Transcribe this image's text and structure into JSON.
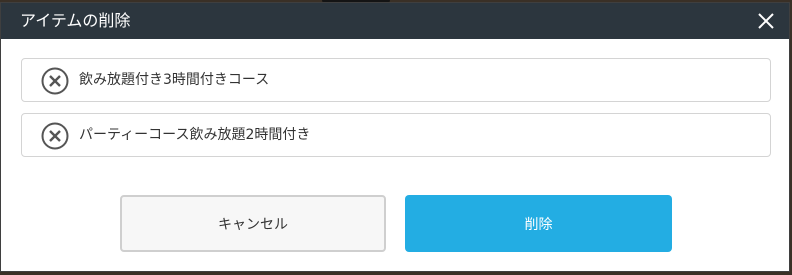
{
  "dialog": {
    "title": "アイテムの削除",
    "close_icon": "close-icon"
  },
  "items": [
    {
      "label": "飲み放題付き3時間付きコース",
      "icon": "remove-circle-icon"
    },
    {
      "label": "パーティーコース飲み放題2時間付き",
      "icon": "remove-circle-icon"
    }
  ],
  "buttons": {
    "cancel_label": "キャンセル",
    "delete_label": "削除"
  },
  "colors": {
    "header_bg": "#2c363e",
    "primary": "#23ade3",
    "cancel_bg": "#f7f7f7"
  }
}
